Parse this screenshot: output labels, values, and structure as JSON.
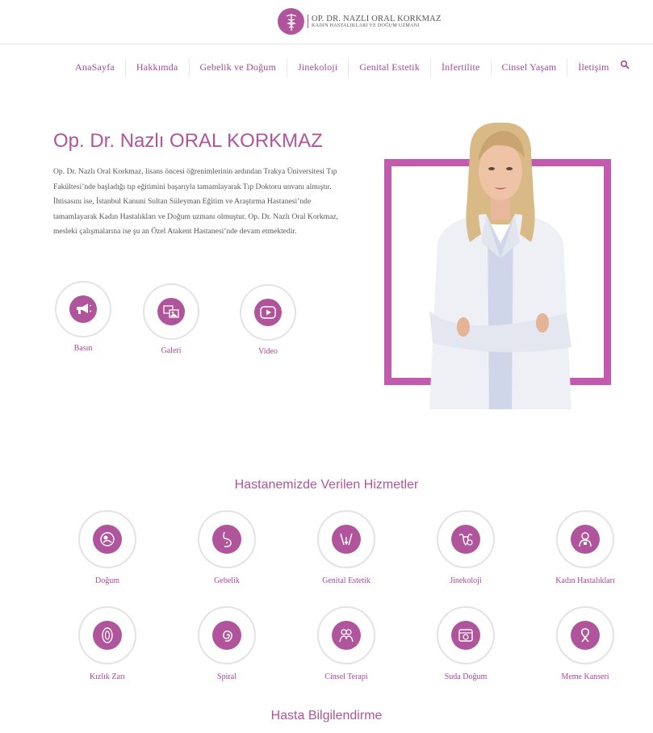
{
  "header": {
    "logo_name": "OP. DR. NAZLI ORAL KORKMAZ",
    "logo_subtitle": "KADIN HASTALIKLARI VE DOĞUM UZMANI"
  },
  "nav": {
    "items": [
      "AnaSayfa",
      "Hakkımda",
      "Gebelik ve Doğum",
      "Jinekoloji",
      "Genital Estetik",
      "İnfertilite",
      "Cinsel Yaşam",
      "İletişim"
    ],
    "search_icon": "search-icon"
  },
  "hero": {
    "title": "Op. Dr. Nazlı ORAL KORKMAZ",
    "text": "Op. Dr. Nazlı Oral Korkmaz, lisans öncesi öğrenimlerinin ardından Trakya Üniversitesi Tıp Fakültesi’nde başladığı tıp eğitimini başarıyla tamamlayarak Tıp Doktoru unvanı almıştır.  İhtisasını ise, İstanbul Kanuni Sultan Süleyman Eğitim ve Araştırma Hastanesi’nde tamamlayarak Kadın Hastalıkları ve Doğum uzmanı olmuştur. Op. Dr. Nazlı Oral Korkmaz, mesleki çalışmalarına ise şu an Özel Atakent Hastanesi’nde devam etmektedir.",
    "quick_links": [
      {
        "label": "Basın",
        "icon": "megaphone-icon"
      },
      {
        "label": "Galeri",
        "icon": "gallery-icon"
      },
      {
        "label": "Video",
        "icon": "play-icon"
      }
    ]
  },
  "services": {
    "title": "Hastanemizde Verilen Hizmetler",
    "items": [
      {
        "label": "Doğum",
        "icon": "birth-icon"
      },
      {
        "label": "Gebelik",
        "icon": "pregnancy-icon"
      },
      {
        "label": "Genital Estetik",
        "icon": "aesthetic-icon"
      },
      {
        "label": "Jinekoloji",
        "icon": "uterus-icon"
      },
      {
        "label": "Kadın Hastalıkları",
        "icon": "woman-icon"
      },
      {
        "label": "Kızlık Zarı",
        "icon": "hymen-icon"
      },
      {
        "label": "Spiral",
        "icon": "spiral-icon"
      },
      {
        "label": "Cinsel Terapi",
        "icon": "couple-icon"
      },
      {
        "label": "Suda Doğum",
        "icon": "water-birth-icon"
      },
      {
        "label": "Meme Kanseri",
        "icon": "ribbon-icon"
      }
    ]
  },
  "info": {
    "title": "Hasta Bilgilendirme"
  },
  "colors": {
    "accent": "#b0559b",
    "frame": "#c25bae"
  }
}
